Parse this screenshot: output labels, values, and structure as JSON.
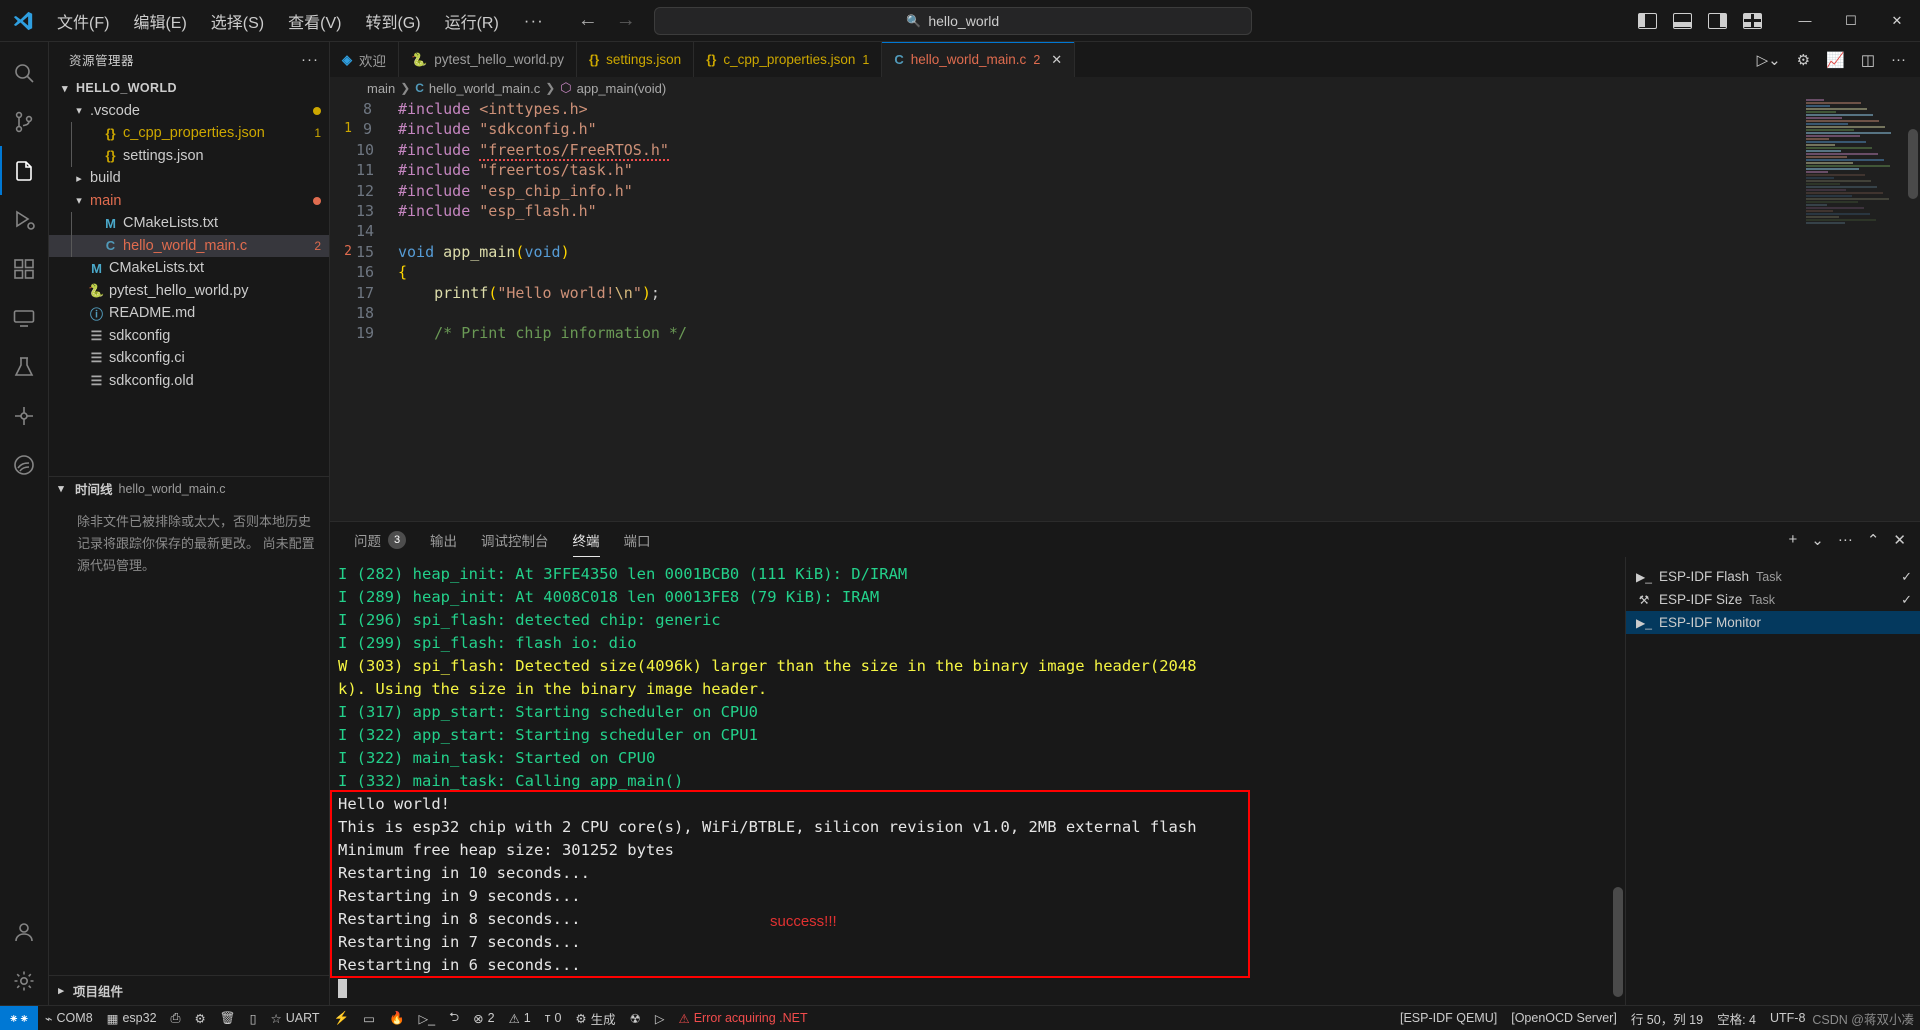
{
  "window": {
    "menus": [
      "文件(F)",
      "编辑(E)",
      "选择(S)",
      "查看(V)",
      "转到(G)",
      "运行(R)"
    ],
    "more_label": "···",
    "back_icon": "arrow-left-icon",
    "forward_icon": "arrow-right-icon",
    "search_value": "hello_world",
    "search_icon": "search-icon",
    "minimize": "—",
    "maximize": "☐",
    "close": "✕"
  },
  "activitybar": {
    "items": [
      {
        "name": "search",
        "icon": "search-icon"
      },
      {
        "name": "source-control",
        "icon": "source-control-icon"
      },
      {
        "name": "explorer",
        "icon": "files-icon"
      },
      {
        "name": "run-debug",
        "icon": "run-debug-icon"
      },
      {
        "name": "extensions",
        "icon": "extensions-icon"
      },
      {
        "name": "remote-explorer",
        "icon": "remote-explorer-icon"
      },
      {
        "name": "testing",
        "icon": "beaker-icon"
      },
      {
        "name": "esp-idf-explorer",
        "icon": "esp-idf-icon"
      },
      {
        "name": "espressif",
        "icon": "espressif-logo-icon"
      }
    ],
    "bottom": [
      {
        "name": "accounts",
        "icon": "account-icon"
      },
      {
        "name": "settings",
        "icon": "gear-icon"
      }
    ]
  },
  "sidebar": {
    "title": "资源管理器",
    "more_actions": "···",
    "tree": [
      {
        "label": "HELLO_WORLD",
        "icon": "chevron-down-icon",
        "depth": 0,
        "kind": "root"
      },
      {
        "label": ".vscode",
        "icon": "chevron-down-icon",
        "depth": 1,
        "kind": "folder",
        "dot": "#cca700"
      },
      {
        "label": "c_cpp_properties.json",
        "icon": "json-icon",
        "depth": 2,
        "kind": "file",
        "badge": "1",
        "badge_color": "#cca700",
        "color": "#cca700"
      },
      {
        "label": "settings.json",
        "icon": "json-icon",
        "depth": 2,
        "kind": "file"
      },
      {
        "label": "build",
        "icon": "chevron-right-icon",
        "depth": 1,
        "kind": "folder"
      },
      {
        "label": "main",
        "icon": "chevron-down-icon",
        "depth": 1,
        "kind": "folder",
        "color": "#e06c4f",
        "dot": "#e06c4f"
      },
      {
        "label": "CMakeLists.txt",
        "icon": "cmake-icon",
        "depth": 2,
        "kind": "file"
      },
      {
        "label": "hello_world_main.c",
        "icon": "c-icon",
        "depth": 2,
        "kind": "file",
        "selected": true,
        "color": "#e06c4f",
        "badge": "2",
        "badge_color": "#e06c4f"
      },
      {
        "label": "CMakeLists.txt",
        "icon": "cmake-icon",
        "depth": 1,
        "kind": "file"
      },
      {
        "label": "pytest_hello_world.py",
        "icon": "python-icon",
        "depth": 1,
        "kind": "file"
      },
      {
        "label": "README.md",
        "icon": "info-icon",
        "depth": 1,
        "kind": "file"
      },
      {
        "label": "sdkconfig",
        "icon": "settings-file-icon",
        "depth": 1,
        "kind": "file"
      },
      {
        "label": "sdkconfig.ci",
        "icon": "settings-file-icon",
        "depth": 1,
        "kind": "file"
      },
      {
        "label": "sdkconfig.old",
        "icon": "settings-file-icon",
        "depth": 1,
        "kind": "file"
      }
    ],
    "timeline": {
      "label": "时间线",
      "file": "hello_world_main.c",
      "message": "除非文件已被排除或太大，否则本地历史记录将跟踪你保存的最新更改。 尚未配置源代码管理。"
    },
    "project_components": "项目组件"
  },
  "editor": {
    "tabs": [
      {
        "label": "欢迎",
        "icon": "vscode-logo-icon",
        "active": false
      },
      {
        "label": "pytest_hello_world.py",
        "icon": "python-icon",
        "active": false
      },
      {
        "label": "settings.json",
        "icon": "json-icon",
        "active": false
      },
      {
        "label": "c_cpp_properties.json",
        "icon": "json-icon",
        "active": false,
        "badge": "1"
      },
      {
        "label": "hello_world_main.c",
        "icon": "c-icon",
        "active": true,
        "badge": "2",
        "close": "✕"
      }
    ],
    "actions": [
      {
        "name": "run-esp-idf",
        "icon": "run-chevron-icon"
      },
      {
        "name": "gear",
        "icon": "gear-icon"
      },
      {
        "name": "flash-chart",
        "icon": "chart-icon"
      },
      {
        "name": "split-editor",
        "icon": "split-editor-icon"
      },
      {
        "name": "more-actions",
        "icon": "ellipsis-icon"
      }
    ],
    "breadcrumb": [
      "main",
      "hello_world_main.c",
      "app_main(void)"
    ],
    "lines": [
      {
        "n": 8,
        "segs": [
          {
            "t": "#include ",
            "c": "k-pre"
          },
          {
            "t": "<inttypes.h>",
            "c": "k-str"
          }
        ]
      },
      {
        "n": 9,
        "segs": [
          {
            "t": "#include ",
            "c": "k-pre"
          },
          {
            "t": "\"sdkconfig.h\"",
            "c": "k-str"
          }
        ]
      },
      {
        "n": 10,
        "segs": [
          {
            "t": "#include ",
            "c": "k-pre"
          },
          {
            "t": "\"freertos/FreeRTOS.h\"",
            "c": "k-str squiggle"
          }
        ]
      },
      {
        "n": 11,
        "segs": [
          {
            "t": "#include ",
            "c": "k-pre"
          },
          {
            "t": "\"freertos/task.h\"",
            "c": "k-str"
          }
        ]
      },
      {
        "n": 12,
        "segs": [
          {
            "t": "#include ",
            "c": "k-pre"
          },
          {
            "t": "\"esp_chip_info.h\"",
            "c": "k-str"
          }
        ]
      },
      {
        "n": 13,
        "segs": [
          {
            "t": "#include ",
            "c": "k-pre"
          },
          {
            "t": "\"esp_flash.h\"",
            "c": "k-str"
          }
        ]
      },
      {
        "n": 14,
        "segs": []
      },
      {
        "n": 15,
        "segs": [
          {
            "t": "void ",
            "c": "k-type"
          },
          {
            "t": "app_main",
            "c": "k-fn"
          },
          {
            "t": "(",
            "c": "k-punc"
          },
          {
            "t": "void",
            "c": "k-type"
          },
          {
            "t": ")",
            "c": "k-punc"
          }
        ]
      },
      {
        "n": 16,
        "segs": [
          {
            "t": "{",
            "c": "k-punc"
          }
        ]
      },
      {
        "n": 17,
        "segs": [
          {
            "t": "    ",
            "c": ""
          },
          {
            "t": "printf",
            "c": "k-fn"
          },
          {
            "t": "(",
            "c": "k-punc"
          },
          {
            "t": "\"Hello world!",
            "c": "k-str"
          },
          {
            "t": "\\n",
            "c": "k-esc"
          },
          {
            "t": "\"",
            "c": "k-str"
          },
          {
            "t": ")",
            "c": "k-punc"
          },
          {
            "t": ";",
            "c": ""
          }
        ]
      },
      {
        "n": 18,
        "segs": []
      },
      {
        "n": 19,
        "segs": [
          {
            "t": "    /* Print chip information */",
            "c": "k-com"
          }
        ]
      }
    ],
    "gutter_marks": [
      {
        "line": 9,
        "text": "1",
        "color": "#cca700"
      },
      {
        "line": 15,
        "text": "2",
        "color": "#e06c4f"
      }
    ]
  },
  "panel": {
    "tabs": [
      {
        "label": "问题",
        "badge": "3",
        "active": false
      },
      {
        "label": "输出",
        "active": false
      },
      {
        "label": "调试控制台",
        "active": false
      },
      {
        "label": "终端",
        "active": true
      },
      {
        "label": "端口",
        "active": false
      }
    ],
    "actions": [
      {
        "name": "new-terminal",
        "icon": "plus-icon"
      },
      {
        "name": "terminal-profile-dropdown",
        "icon": "chevron-down-icon"
      },
      {
        "name": "panel-more-actions",
        "icon": "ellipsis-icon"
      },
      {
        "name": "maximize-panel",
        "icon": "chevron-up-icon"
      },
      {
        "name": "close-panel",
        "icon": "close-icon"
      }
    ],
    "terminal_output": [
      {
        "text": "I (282) heap_init: At 3FFE4350 len 0001BCB0 (111 KiB): D/IRAM",
        "color": "t-green"
      },
      {
        "text": "I (289) heap_init: At 4008C018 len 00013FE8 (79 KiB): IRAM",
        "color": "t-green"
      },
      {
        "text": "I (296) spi_flash: detected chip: generic",
        "color": "t-green"
      },
      {
        "text": "I (299) spi_flash: flash io: dio",
        "color": "t-green"
      },
      {
        "text": "W (303) spi_flash: Detected size(4096k) larger than the size in the binary image header(2048",
        "color": "t-yellow"
      },
      {
        "text": "k). Using the size in the binary image header.",
        "color": "t-yellow"
      },
      {
        "text": "I (317) app_start: Starting scheduler on CPU0",
        "color": "t-green"
      },
      {
        "text": "I (322) app_start: Starting scheduler on CPU1",
        "color": "t-green"
      },
      {
        "text": "I (322) main_task: Started on CPU0",
        "color": "t-green"
      },
      {
        "text": "I (332) main_task: Calling app_main()",
        "color": "t-green"
      },
      {
        "text": "Hello world!",
        "color": "t-white"
      },
      {
        "text": "This is esp32 chip with 2 CPU core(s), WiFi/BTBLE, silicon revision v1.0, 2MB external flash",
        "color": "t-white"
      },
      {
        "text": "Minimum free heap size: 301252 bytes",
        "color": "t-white"
      },
      {
        "text": "Restarting in 10 seconds...",
        "color": "t-white"
      },
      {
        "text": "Restarting in 9 seconds...",
        "color": "t-white"
      },
      {
        "text": "Restarting in 8 seconds...",
        "color": "t-white"
      },
      {
        "text": "Restarting in 7 seconds...",
        "color": "t-white"
      },
      {
        "text": "Restarting in 6 seconds...",
        "color": "t-white"
      }
    ],
    "annotation": "success!!!",
    "annotation_color": "#e03131",
    "highlight_color": "#ff0000",
    "terminal_list": [
      {
        "label": "ESP-IDF Flash",
        "sub": "Task",
        "icon": "terminal-icon",
        "check": "✓",
        "active": false
      },
      {
        "label": "ESP-IDF Size",
        "sub": "Task",
        "icon": "tools-icon",
        "check": "✓",
        "active": false
      },
      {
        "label": "ESP-IDF Monitor",
        "sub": "",
        "icon": "terminal-icon",
        "check": "",
        "active": true
      }
    ]
  },
  "statusbar": {
    "remote_icon": "remote-connect-icon",
    "left": [
      {
        "icon": "plug-icon",
        "label": "COM8"
      },
      {
        "icon": "chip-icon",
        "label": "esp32"
      },
      {
        "icon": "board-icon",
        "label": ""
      },
      {
        "icon": "gear-icon",
        "label": ""
      },
      {
        "icon": "trash-icon",
        "label": ""
      },
      {
        "icon": "build-icon",
        "label": ""
      },
      {
        "icon": "star-icon",
        "label": "UART"
      },
      {
        "icon": "flash-icon",
        "label": ""
      },
      {
        "icon": "monitor-icon",
        "label": ""
      },
      {
        "icon": "flame-icon",
        "label": ""
      },
      {
        "icon": "terminal-icon",
        "label": ""
      },
      {
        "icon": "export-icon",
        "label": ""
      },
      {
        "icon": "error-icon",
        "label": "2"
      },
      {
        "icon": "warning-icon",
        "label": "1"
      },
      {
        "icon": "radio-tower-icon",
        "label": "0"
      },
      {
        "icon": "gear-icon",
        "label": "生成"
      },
      {
        "icon": "debug-icon",
        "label": ""
      },
      {
        "icon": "play-icon",
        "label": ""
      },
      {
        "icon": "alert-icon",
        "label": "Error acquiring .NET",
        "color": "#f14c4c"
      }
    ],
    "right": [
      {
        "label": "[ESP-IDF QEMU]"
      },
      {
        "label": "[OpenOCD Server]"
      },
      {
        "label": "行 50，列 19"
      },
      {
        "label": "空格: 4"
      },
      {
        "label": "UTF-8"
      }
    ],
    "watermark": "CSDN @蒋双小凑"
  }
}
